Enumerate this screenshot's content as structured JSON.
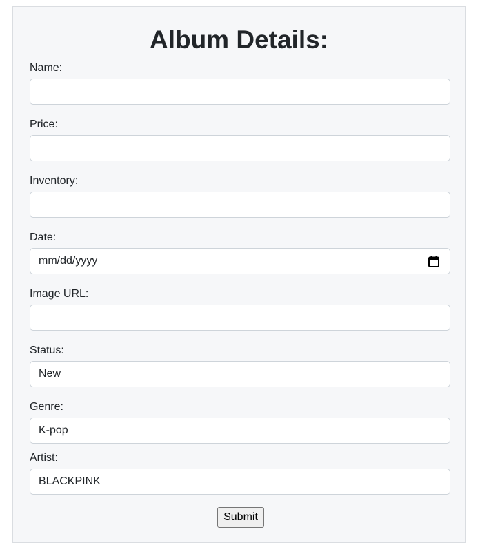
{
  "form": {
    "title": "Album Details:",
    "fields": [
      {
        "label": "Name:",
        "value": ""
      },
      {
        "label": "Price:",
        "value": ""
      },
      {
        "label": "Inventory:",
        "value": ""
      },
      {
        "label": "Date:",
        "placeholder": "mm/dd/yyyy",
        "icon": "calendar-icon"
      },
      {
        "label": "Image URL:",
        "value": ""
      },
      {
        "label": "Status:",
        "value": "New"
      },
      {
        "label": "Genre:",
        "value": "K-pop"
      },
      {
        "label": "Artist:",
        "value": "BLACKPINK"
      }
    ],
    "submit_label": "Submit"
  }
}
